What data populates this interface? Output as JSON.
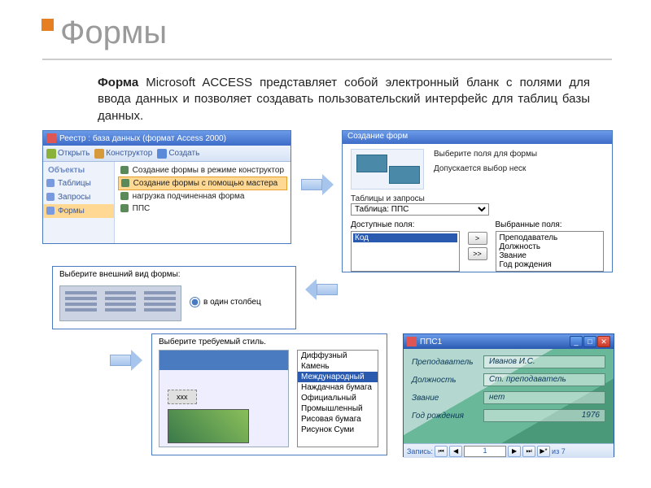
{
  "slide": {
    "title": "Формы",
    "body_strong": "Форма",
    "body_rest": " Microsoft ACCESS представляет собой электронный бланк с полями для ввода данных и позволяет создавать пользовательский интерфейс для таблиц базы данных."
  },
  "win1": {
    "title": "Реестр : база данных (формат Access 2000)",
    "toolbar": {
      "open": "Открыть",
      "design": "Конструктор",
      "create": "Создать"
    },
    "sidebar_header": "Объекты",
    "sidebar": [
      "Таблицы",
      "Запросы",
      "Формы"
    ],
    "list": [
      "Создание формы в режиме конструктор",
      "Создание формы с помощью мастера",
      "нагрузка подчиненная форма",
      "ППС"
    ],
    "selected_list_index": 1
  },
  "win2": {
    "title": "Создание форм",
    "hint1": "Выберите поля для формы",
    "hint2": "Допускается выбор неск",
    "tbl_label": "Таблицы и запросы",
    "tbl_value": "Таблица: ППС",
    "avail_label": "Доступные поля:",
    "avail_items": [
      "Код"
    ],
    "sel_label": "Выбранные поля:",
    "sel_items": [
      "Преподаватель",
      "Должность",
      "Звание",
      "Год рождения"
    ],
    "btns": [
      ">",
      ">>"
    ]
  },
  "win3": {
    "prompt": "Выберите внешний вид формы:",
    "radio": "в один столбец"
  },
  "win4": {
    "prompt": "Выберите требуемый стиль.",
    "label_marker": "xxx",
    "styles": [
      "Диффузный",
      "Камень",
      "Международный",
      "Наждачная бумага",
      "Официальный",
      "Промышленный",
      "Рисовая бумага",
      "Рисунок Суми"
    ],
    "selected_style_index": 2
  },
  "win5": {
    "title": "ППС1",
    "rows": [
      {
        "label": "Преподаватель",
        "value": "Иванов И.С."
      },
      {
        "label": "Должность",
        "value": "Ст. преподаватель"
      },
      {
        "label": "Звание",
        "value": "нет"
      },
      {
        "label": "Год рождения",
        "value": "1976"
      }
    ],
    "nav": {
      "label": "Запись:",
      "pos": "1",
      "total": "из 7"
    }
  }
}
